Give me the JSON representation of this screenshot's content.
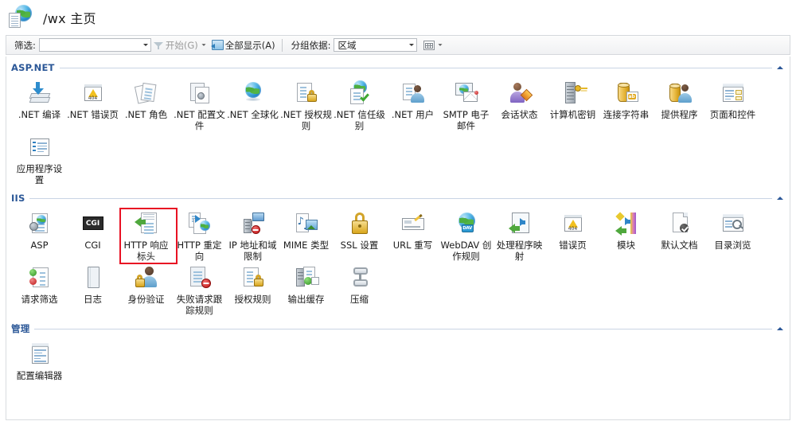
{
  "window": {
    "title": "/wx 主页",
    "title_icon": "globe-page-icon"
  },
  "toolbar": {
    "filter_label": "筛选:",
    "filter_value": "",
    "filter_placeholder": "",
    "start_label": "开始(G)",
    "start_icon": "funnel-icon",
    "show_all_label": "全部显示(A)",
    "show_all_icon": "show-all-icon",
    "group_by_label": "分组依据:",
    "group_by_value": "区域",
    "views_icon": "view-grid-icon"
  },
  "colors": {
    "group_header": "#2b5797",
    "selection": "#e81123",
    "pane_border": "#d9dcdf"
  },
  "groups": [
    {
      "name": "ASP.NET",
      "collapse_icon": "chevron-up-icon",
      "items": [
        {
          "label": ".NET 编译",
          "icon": "net-compilation-icon"
        },
        {
          "label": ".NET 错误页",
          "icon": "net-error-pages-icon"
        },
        {
          "label": ".NET 角色",
          "icon": "net-roles-icon"
        },
        {
          "label": ".NET 配置文件",
          "icon": "net-profile-icon"
        },
        {
          "label": ".NET 全球化",
          "icon": "net-globalization-icon"
        },
        {
          "label": ".NET 授权规则",
          "icon": "net-authorization-rules-icon"
        },
        {
          "label": ".NET 信任级别",
          "icon": "net-trust-levels-icon"
        },
        {
          "label": ".NET 用户",
          "icon": "net-users-icon"
        },
        {
          "label": "SMTP 电子邮件",
          "icon": "smtp-email-icon"
        },
        {
          "label": "会话状态",
          "icon": "session-state-icon"
        },
        {
          "label": "计算机密钥",
          "icon": "machine-key-icon"
        },
        {
          "label": "连接字符串",
          "icon": "connection-strings-icon"
        },
        {
          "label": "提供程序",
          "icon": "providers-icon"
        },
        {
          "label": "页面和控件",
          "icon": "pages-and-controls-icon"
        },
        {
          "label": "应用程序设置",
          "icon": "application-settings-icon"
        }
      ]
    },
    {
      "name": "IIS",
      "collapse_icon": "chevron-up-icon",
      "items": [
        {
          "label": "ASP",
          "icon": "asp-icon"
        },
        {
          "label": "CGI",
          "icon": "cgi-icon"
        },
        {
          "label": "HTTP 响应标头",
          "icon": "http-response-headers-icon",
          "selected": true
        },
        {
          "label": "HTTP 重定向",
          "icon": "http-redirect-icon"
        },
        {
          "label": "IP 地址和域限制",
          "icon": "ip-address-domain-restrictions-icon"
        },
        {
          "label": "MIME 类型",
          "icon": "mime-types-icon"
        },
        {
          "label": "SSL 设置",
          "icon": "ssl-settings-icon"
        },
        {
          "label": "URL 重写",
          "icon": "url-rewrite-icon"
        },
        {
          "label": "WebDAV 创作规则",
          "icon": "webdav-authoring-rules-icon"
        },
        {
          "label": "处理程序映射",
          "icon": "handler-mappings-icon"
        },
        {
          "label": "错误页",
          "icon": "error-pages-icon"
        },
        {
          "label": "模块",
          "icon": "modules-icon"
        },
        {
          "label": "默认文档",
          "icon": "default-document-icon"
        },
        {
          "label": "目录浏览",
          "icon": "directory-browsing-icon"
        },
        {
          "label": "请求筛选",
          "icon": "request-filtering-icon"
        },
        {
          "label": "日志",
          "icon": "logging-icon"
        },
        {
          "label": "身份验证",
          "icon": "authentication-icon"
        },
        {
          "label": "失败请求跟踪规则",
          "icon": "failed-request-tracing-rules-icon"
        },
        {
          "label": "授权规则",
          "icon": "authorization-rules-icon"
        },
        {
          "label": "输出缓存",
          "icon": "output-caching-icon"
        },
        {
          "label": "压缩",
          "icon": "compression-icon"
        }
      ]
    },
    {
      "name": "管理",
      "collapse_icon": "chevron-up-icon",
      "items": [
        {
          "label": "配置编辑器",
          "icon": "configuration-editor-icon"
        }
      ]
    }
  ]
}
